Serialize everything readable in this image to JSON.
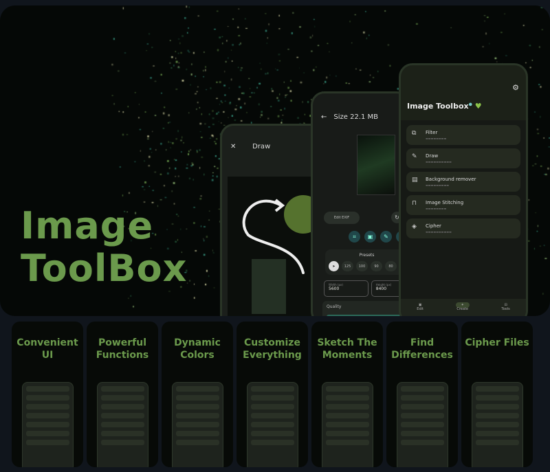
{
  "hero": {
    "title_line1": "Image",
    "title_line2": "ToolBox"
  },
  "draw_screen": {
    "title": "Draw",
    "close_icon": "close-icon"
  },
  "resize_screen": {
    "title": "Size 22.1 MB",
    "edit_exif": "Edit EXIF",
    "presets_label": "Presets",
    "presets": [
      "125",
      "100",
      "90",
      "80"
    ],
    "width_label": "Width (px)",
    "width_value": "5600",
    "height_label": "Height (px)",
    "height_value": "8400",
    "quality_label": "Quality"
  },
  "main_screen": {
    "app_title": "Image Toolbox",
    "items": [
      {
        "title": "Filter",
        "icon": "filter-icon"
      },
      {
        "title": "Draw",
        "icon": "draw-icon"
      },
      {
        "title": "Background remover",
        "icon": "eraser-icon"
      },
      {
        "title": "Image Stitching",
        "icon": "stitch-icon"
      },
      {
        "title": "Cipher",
        "icon": "shield-icon"
      }
    ],
    "nav": [
      "Edit",
      "Create",
      "Tools"
    ]
  },
  "features": [
    {
      "line1": "Convenient",
      "line2": "UI"
    },
    {
      "line1": "Powerful",
      "line2": "Functions"
    },
    {
      "line1": "Dynamic",
      "line2": "Colors"
    },
    {
      "line1": "Customize",
      "line2": "Everything"
    },
    {
      "line1": "Sketch The",
      "line2": "Moments"
    },
    {
      "line1": "Find",
      "line2": "Differences"
    },
    {
      "line1": "Cipher Files",
      "line2": ""
    }
  ],
  "colors": {
    "accent": "#6b9a4c",
    "background": "#10151c"
  }
}
